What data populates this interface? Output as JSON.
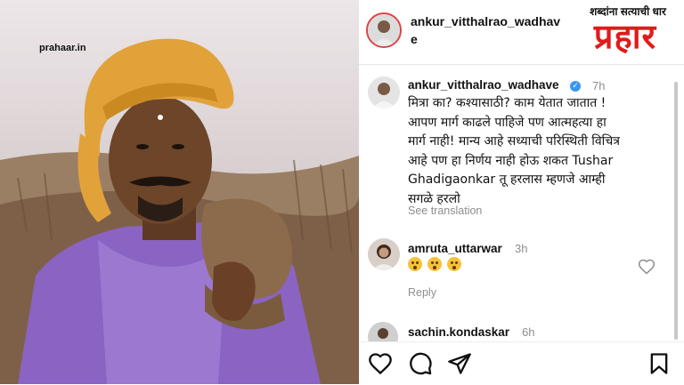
{
  "watermark": "prahaar.in",
  "header": {
    "username": "ankur_vitthalrao_wadhave",
    "tagline": "शब्दांना सत्याची धार",
    "logo_text": "प्रहार"
  },
  "comment": {
    "username": "ankur_vitthalrao_wadhave",
    "time": "7h",
    "text": "मित्रा का? कश्यासाठी? काम येतात जातात !\nआपण मार्ग काढले पाहिजे पण आत्महत्या हा\nमार्ग नाही! मान्य आहे सध्याची परिस्थिती विचित्र\nआहे पण हा निर्णय नाही होऊ शकत Tushar\nGhadigaonkar तू हरलास म्हणजे आम्ही\nसगळे हरलो",
    "see_translation": "See translation"
  },
  "reply1": {
    "username": "amruta_uttarwar",
    "time": "3h",
    "emoji_count": 3,
    "reply_label": "Reply"
  },
  "reply2": {
    "username": "sachin.kondaskar",
    "time": "6h"
  },
  "icons": [
    "heart-icon",
    "comment-icon",
    "share-icon",
    "bookmark-icon"
  ]
}
